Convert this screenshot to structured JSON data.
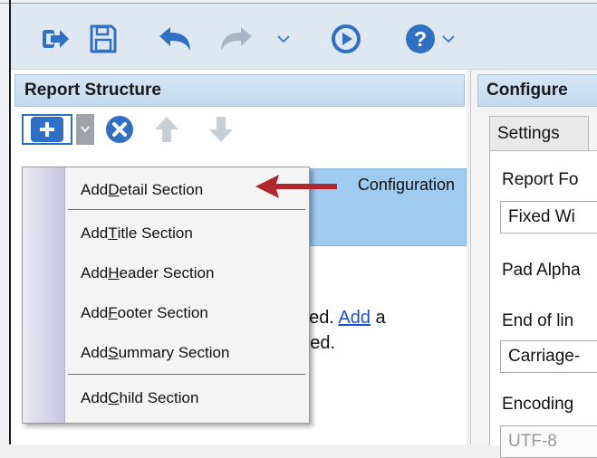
{
  "toolbar": {
    "buttons": [
      "exit-icon",
      "save-icon",
      "undo-icon",
      "redo-icon",
      "run-icon",
      "help-icon"
    ]
  },
  "panels": {
    "left_title": "Report Structure",
    "right_title": "Configure"
  },
  "tree": {
    "selected_label": "Configuration"
  },
  "body": {
    "line1_prefix": "ded.",
    "line1_link": "Add",
    "line1_suffix": "a",
    "line2": "rted."
  },
  "right": {
    "tab_label": "Settings",
    "report_format_label": "Report Fo",
    "report_format_value": "Fixed Wi",
    "pad_label": "Pad Alpha",
    "eol_label": "End of lin",
    "eol_value": "Carriage-",
    "encoding_label": "Encoding",
    "encoding_value": "UTF-8"
  },
  "menu": {
    "items": [
      {
        "pre": "Add ",
        "u": "D",
        "post": "etail Section"
      },
      {
        "pre": "Add ",
        "u": "T",
        "post": "itle Section"
      },
      {
        "pre": "Add ",
        "u": "H",
        "post": "eader Section"
      },
      {
        "pre": "Add ",
        "u": "F",
        "post": "ooter Section"
      },
      {
        "pre": "Add ",
        "u": "S",
        "post": "ummary Section"
      },
      {
        "pre": "Add ",
        "u": "C",
        "post": "hild Section"
      }
    ]
  },
  "colors": {
    "accent": "#2f6fc4",
    "arrow": "#b0262a",
    "selection": "#9fcbf0"
  }
}
